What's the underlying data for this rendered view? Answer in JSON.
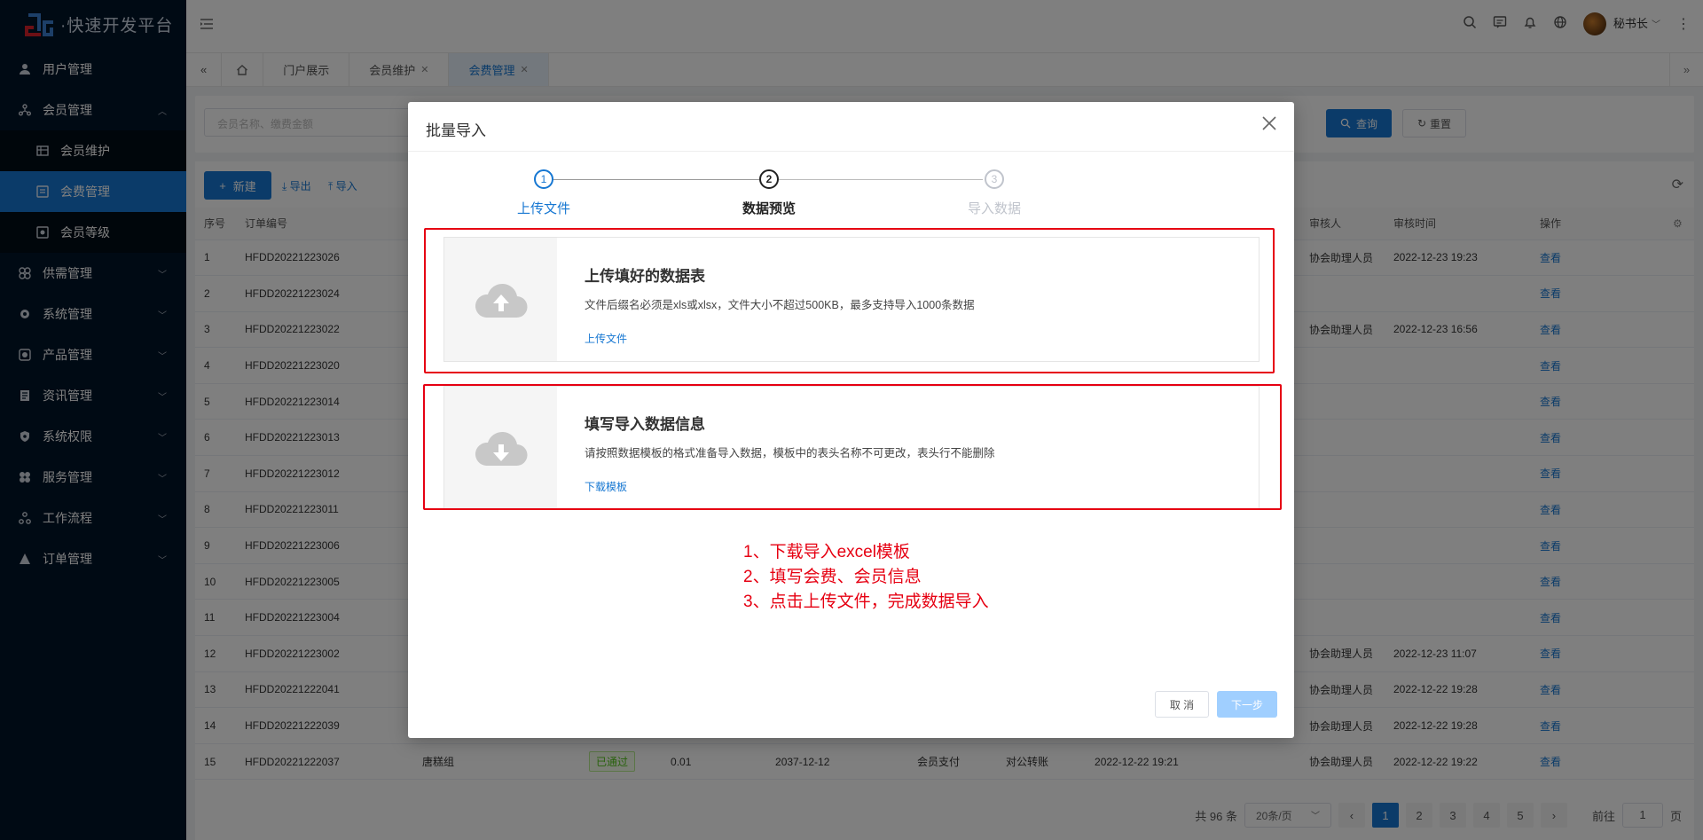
{
  "app": {
    "logo_text": "·快速开发平台"
  },
  "sidebar": {
    "items": [
      {
        "label": "用户管理",
        "icon": "user-icon"
      },
      {
        "label": "会员管理",
        "icon": "members-icon",
        "expanded": true
      },
      {
        "label": "供需管理",
        "icon": "supply-icon"
      },
      {
        "label": "系统管理",
        "icon": "gear-icon"
      },
      {
        "label": "产品管理",
        "icon": "product-icon"
      },
      {
        "label": "资讯管理",
        "icon": "news-icon"
      },
      {
        "label": "系统权限",
        "icon": "shield-icon"
      },
      {
        "label": "服务管理",
        "icon": "service-icon"
      },
      {
        "label": "工作流程",
        "icon": "workflow-icon"
      },
      {
        "label": "订单管理",
        "icon": "order-icon"
      }
    ],
    "sub_items": [
      {
        "label": "会员维护",
        "icon": "table-icon"
      },
      {
        "label": "会费管理",
        "icon": "fee-icon",
        "active": true
      },
      {
        "label": "会员等级",
        "icon": "level-icon"
      }
    ]
  },
  "header": {
    "user_name": "秘书长"
  },
  "tabs": [
    {
      "label": "门户展示"
    },
    {
      "label": "会员维护"
    },
    {
      "label": "会费管理",
      "active": true
    }
  ],
  "search": {
    "placeholder": "会员名称、缴费金额",
    "query_label": "查询",
    "reset_label": "重置"
  },
  "toolbar": {
    "new_label": "新建",
    "export_label": "导出",
    "import_label": "导入"
  },
  "table": {
    "headers": [
      "序号",
      "订单编号",
      "审核人",
      "审核时间",
      "操作"
    ],
    "rows": [
      {
        "no": "1",
        "order": "HFDD20221223026",
        "reviewer": "协会助理人员",
        "time": "2022-12-23 19:23",
        "op": "查看"
      },
      {
        "no": "2",
        "order": "HFDD20221223024",
        "reviewer": "",
        "time": "",
        "op": "查看"
      },
      {
        "no": "3",
        "order": "HFDD20221223022",
        "reviewer": "协会助理人员",
        "time": "2022-12-23 16:56",
        "op": "查看"
      },
      {
        "no": "4",
        "order": "HFDD20221223020",
        "reviewer": "",
        "time": "",
        "op": "查看"
      },
      {
        "no": "5",
        "order": "HFDD20221223014",
        "reviewer": "",
        "time": "",
        "op": "查看"
      },
      {
        "no": "6",
        "order": "HFDD20221223013",
        "reviewer": "",
        "time": "",
        "op": "查看"
      },
      {
        "no": "7",
        "order": "HFDD20221223012",
        "reviewer": "",
        "time": "",
        "op": "查看"
      },
      {
        "no": "8",
        "order": "HFDD20221223011",
        "reviewer": "",
        "time": "",
        "op": "查看"
      },
      {
        "no": "9",
        "order": "HFDD20221223006",
        "reviewer": "",
        "time": "",
        "op": "查看"
      },
      {
        "no": "10",
        "order": "HFDD20221223005",
        "reviewer": "",
        "time": "",
        "op": "查看"
      },
      {
        "no": "11",
        "order": "HFDD20221223004",
        "reviewer": "",
        "time": "",
        "op": "查看"
      },
      {
        "no": "12",
        "order": "HFDD20221223002",
        "reviewer": "协会助理人员",
        "time": "2022-12-23 11:07",
        "op": "查看"
      },
      {
        "no": "13",
        "order": "HFDD20221222041",
        "reviewer": "协会助理人员",
        "time": "2022-12-22 19:28",
        "op": "查看"
      },
      {
        "no": "14",
        "order": "HFDD20221222039",
        "reviewer": "协会助理人员",
        "time": "2022-12-22 19:28",
        "op": "查看"
      }
    ],
    "last_row": {
      "no": "15",
      "order": "HFDD20221222037",
      "member": "唐糕组",
      "status": "已通过",
      "amount": "0.01",
      "expire": "2037-12-12",
      "pay_type": "会员支付",
      "pay_method": "对公转账",
      "created": "2022-12-22 19:21",
      "reviewer": "协会助理人员",
      "time": "2022-12-22 19:22",
      "op": "查看"
    }
  },
  "pager": {
    "total": "共 96 条",
    "page_size": "20条/页",
    "pages": [
      "1",
      "2",
      "3",
      "4",
      "5"
    ],
    "goto_label": "前往",
    "goto_value": "1",
    "page_suffix": "页"
  },
  "modal": {
    "title": "批量导入",
    "steps": [
      {
        "num": "1",
        "label": "上传文件",
        "state": "done"
      },
      {
        "num": "2",
        "label": "数据预览",
        "state": "current"
      },
      {
        "num": "3",
        "label": "导入数据",
        "state": "wait"
      }
    ],
    "upload": {
      "title": "上传填好的数据表",
      "desc": "文件后缀名必须是xls或xlsx，文件大小不超过500KB，最多支持导入1000条数据",
      "link": "上传文件"
    },
    "template": {
      "title": "填写导入数据信息",
      "desc": "请按照数据模板的格式准备导入数据，模板中的表头名称不可更改，表头行不能删除",
      "link": "下载模板"
    },
    "instructions": [
      "1、下载导入excel模板",
      "2、填写会费、会员信息",
      "3、点击上传文件，完成数据导入"
    ],
    "cancel_label": "取 消",
    "next_label": "下一步"
  }
}
